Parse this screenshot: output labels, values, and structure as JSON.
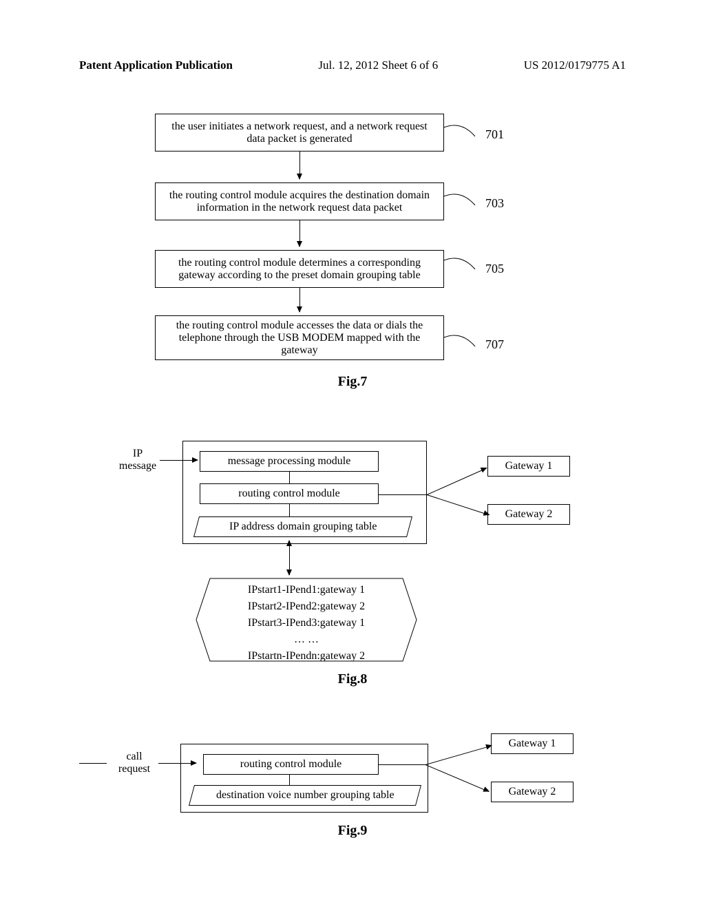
{
  "header": {
    "left": "Patent Application Publication",
    "center": "Jul. 12, 2012   Sheet 6 of 6",
    "right": "US 2012/0179775 A1"
  },
  "fig7": {
    "box1": "the user initiates a network request, and a network request data packet is generated",
    "num1": "701",
    "box2": "the routing control module acquires the destination domain information in the network request data packet",
    "num2": "703",
    "box3": "the routing control module determines a corresponding gateway according to the preset domain grouping table",
    "num3": "705",
    "box4": "the routing control module accesses the data or dials the telephone through the USB MODEM mapped with the gateway",
    "num4": "707",
    "caption": "Fig.7"
  },
  "fig8": {
    "ip_label": "IP\nmessage",
    "msg_proc": "message processing module",
    "routing": "routing control module",
    "grouping": "IP address domain grouping table",
    "gw1": "Gateway 1",
    "gw2": "Gateway 2",
    "table_content": "IPstart1-IPend1:gateway 1\nIPstart2-IPend2:gateway 2\nIPstart3-IPend3:gateway 1\n… …\nIPstartn-IPendn:gateway 2",
    "caption": "Fig.8"
  },
  "fig9": {
    "call_label": "call\nrequest",
    "routing": "routing control module",
    "grouping": "destination voice number grouping table",
    "gw1": "Gateway 1",
    "gw2": "Gateway 2",
    "caption": "Fig.9"
  }
}
